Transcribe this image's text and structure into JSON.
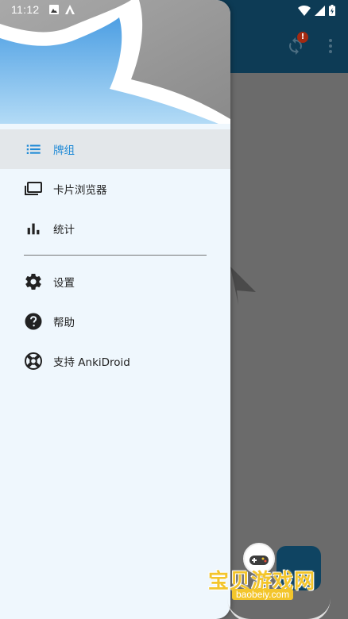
{
  "status_bar": {
    "time": "11:12"
  },
  "app_toolbar": {
    "sync_badge": "!"
  },
  "drawer": {
    "items": [
      {
        "label": "牌组",
        "icon": "list-icon",
        "active": true
      },
      {
        "label": "卡片浏览器",
        "icon": "card-browser-icon",
        "active": false
      },
      {
        "label": "统计",
        "icon": "bar-chart-icon",
        "active": false
      },
      {
        "label": "设置",
        "icon": "gear-icon",
        "active": false
      },
      {
        "label": "帮助",
        "icon": "help-icon",
        "active": false
      },
      {
        "label": "支持 AnkiDroid",
        "icon": "lifebuoy-icon",
        "active": false
      }
    ]
  },
  "watermark": {
    "text": "宝贝游戏网",
    "url": "baobeiy.com"
  },
  "colors": {
    "accent": "#1f8ad6",
    "toolbar": "#0d3b55",
    "drawer_bg": "#eff7fd",
    "active_bg": "#e3e7ea",
    "scrim": "#6b6b6b",
    "header_sky_top": "#5aa8e6",
    "header_sky_bottom": "#a9d3f3"
  }
}
